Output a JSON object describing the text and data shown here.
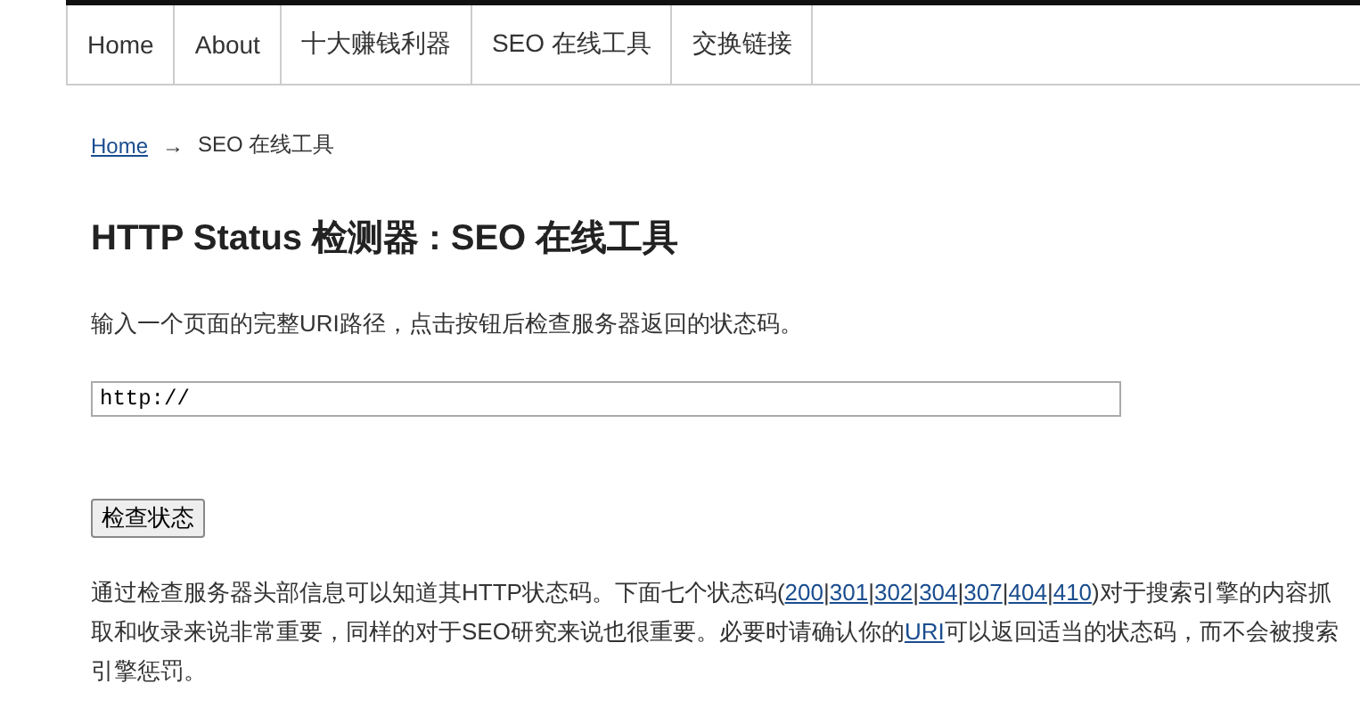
{
  "nav": [
    {
      "label": "Home",
      "selected": false
    },
    {
      "label": "About",
      "selected": false
    },
    {
      "label": "十大赚钱利器",
      "selected": false
    },
    {
      "label": "SEO 在线工具",
      "selected": false
    },
    {
      "label": "交换链接",
      "selected": false
    }
  ],
  "breadcrumb": {
    "link": "Home",
    "separator": "→",
    "current": "SEO 在线工具"
  },
  "title": "HTTP Status 检测器 : SEO 在线工具",
  "intro": "输入一个页面的完整URI路径，点击按钮后检查服务器返回的状态码。",
  "url_field": {
    "value": "http://"
  },
  "check_button": "检查状态",
  "paragraph": [
    {
      "kind": "text",
      "text": "通过检查服务器头部信息可以知道其HTTP状态码。下面七个状态码("
    },
    {
      "kind": "link",
      "text": "200"
    },
    {
      "kind": "text",
      "text": "|"
    },
    {
      "kind": "link",
      "text": "301"
    },
    {
      "kind": "text",
      "text": "|"
    },
    {
      "kind": "link",
      "text": "302"
    },
    {
      "kind": "text",
      "text": "|"
    },
    {
      "kind": "link",
      "text": "304"
    },
    {
      "kind": "text",
      "text": "|"
    },
    {
      "kind": "link",
      "text": "307"
    },
    {
      "kind": "text",
      "text": "|"
    },
    {
      "kind": "link",
      "text": "404"
    },
    {
      "kind": "text",
      "text": "|"
    },
    {
      "kind": "link",
      "text": "410"
    },
    {
      "kind": "text",
      "text": ")对于搜索引擎的内容抓取和收录来说非常重要，同样的对于SEO研究来说也很重要。必要时请确认你的"
    },
    {
      "kind": "link",
      "text": "URI"
    },
    {
      "kind": "text",
      "text": "可以返回适当的状态码，而不会被搜索引擎惩罚。"
    }
  ]
}
